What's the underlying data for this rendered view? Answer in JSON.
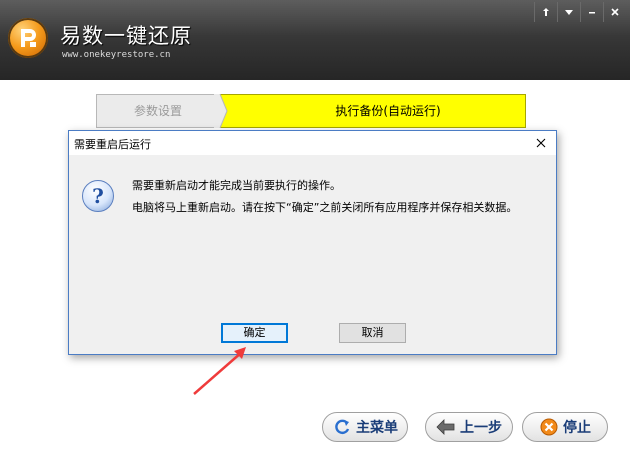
{
  "app": {
    "title": "易数一键还原",
    "url": "www.onekeyrestore.cn",
    "window_controls": [
      "pin-icon",
      "dropdown-icon",
      "minimize-icon",
      "close-icon"
    ]
  },
  "steps": [
    {
      "label": "参数设置",
      "active": false
    },
    {
      "label": "执行备份(自动运行)",
      "active": true
    }
  ],
  "dialog": {
    "title": "需要重启后运行",
    "message_line1": "需要重新启动才能完成当前要执行的操作。",
    "message_line2": "电脑将马上重新启动。请在按下“确定”之前关闭所有应用程序并保存相关数据。",
    "ok_label": "确定",
    "cancel_label": "取消",
    "icon": "question-icon"
  },
  "bottom_buttons": {
    "main_menu": "主菜单",
    "prev": "上一步",
    "stop": "停止"
  },
  "colors": {
    "header_bg": "#333333",
    "active_step": "#ffff00",
    "annotation": "#ef3b3b",
    "dialog_border": "#4b7cc4"
  }
}
